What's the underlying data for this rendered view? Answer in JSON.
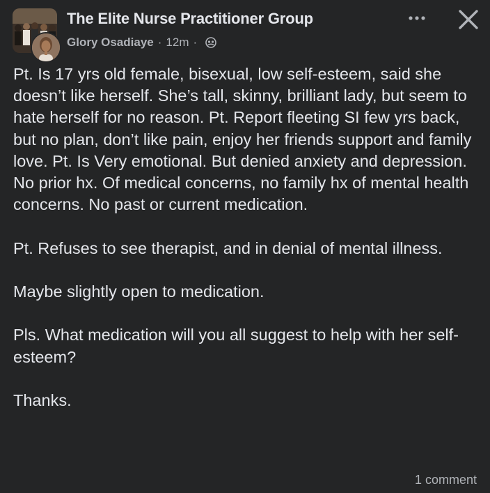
{
  "header": {
    "group_name": "The Elite Nurse Practitioner Group",
    "author": "Glory Osadiaye",
    "separator": "·",
    "time": "12m",
    "audience_icon": "group-audience-icon",
    "more_icon": "more-options-icon",
    "close_icon": "close-icon"
  },
  "post": {
    "paragraphs": [
      "Pt. Is 17 yrs old female, bisexual, low self-esteem, said she doesn’t like herself.  She’s tall, skinny, brilliant lady, but seem to hate herself for no reason.  Pt. Report fleeting SI few yrs back, but no plan, don’t like pain, enjoy her friends support and family love.  Pt. Is Very emotional. But denied anxiety and depression.  No prior hx. Of medical concerns, no family hx of mental health concerns.  No past or current medication.",
      "Pt.  Refuses to see therapist, and in denial of mental illness.",
      "Maybe slightly open to medication.",
      "Pls. What medication will you all suggest to help with her self-esteem?",
      "Thanks."
    ]
  },
  "footer": {
    "comment_count": "1 comment"
  },
  "colors": {
    "background": "#242526",
    "primary_text": "#e4e6eb",
    "secondary_text": "#b0b3b8"
  }
}
